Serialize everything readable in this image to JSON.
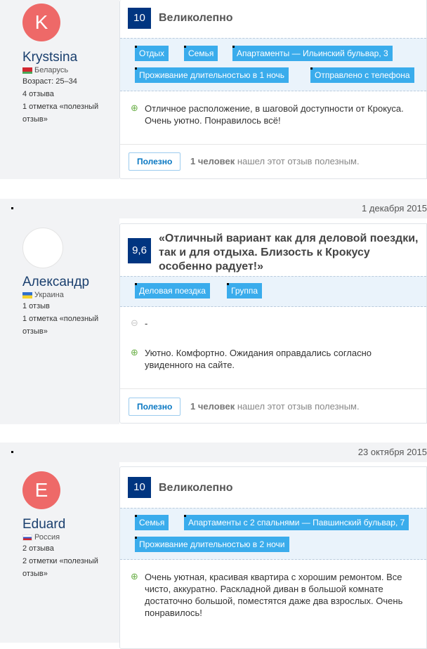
{
  "reviews": [
    {
      "date": "",
      "user": {
        "initial": "K",
        "name": "Krystsina",
        "country": "Беларусь",
        "age": "Возраст: 25–34",
        "reviews_count": "4 отзыва",
        "helpful_marks": "1 отметка «полезный отзыв»"
      },
      "score": "10",
      "headline": "Великолепно",
      "tags": [
        "Отдых",
        "Семья",
        "Апартаменты — Ильинский бульвар, 3",
        "Проживание длительностью в 1 ночь",
        "Отправлено с телефона"
      ],
      "positive": "Отличное расположение, в шаговой доступности от Крокуса. Очень уютно. Понравилось всё!",
      "negative": "",
      "helpful_button": "Полезно",
      "helpful_count": "1 человек",
      "helpful_text": "нашел этот отзыв полезным."
    },
    {
      "date": "1 декабря 2015",
      "user": {
        "initial": "",
        "name": "Александр",
        "country": "Украина",
        "age": "",
        "reviews_count": "1 отзыв",
        "helpful_marks": "1 отметка «полезный отзыв»"
      },
      "score": "9,6",
      "headline": "«Отличный вариант как для деловой поездки, так и для отдыха. Близость к Крокусу особенно радует!»",
      "tags": [
        "Деловая поездка",
        "Группа"
      ],
      "positive": "Уютно. Комфортно. Ожидания оправдались согласно увиденного на сайте.",
      "negative": "-",
      "helpful_button": "Полезно",
      "helpful_count": "1 человек",
      "helpful_text": "нашел этот отзыв полезным."
    },
    {
      "date": "23 октября 2015",
      "user": {
        "initial": "E",
        "name": "Eduard",
        "country": "Россия",
        "age": "",
        "reviews_count": "2 отзыва",
        "helpful_marks": "2 отметки «полезный отзыв»"
      },
      "score": "10",
      "headline": "Великолепно",
      "tags": [
        "Семья",
        "Апартаменты с 2 спальнями — Павшинский бульвар, 7",
        "Проживание длительностью в 2 ночи"
      ],
      "positive": "Очень уютная, красивая квартира с хорошим ремонтом. Все чисто, аккуратно. Раскладной диван в большой комнате достаточно большой, поместятся даже два взрослых. Очень понравилось!",
      "negative": ""
    }
  ],
  "icons": {
    "positive": "plus-leaf-icon",
    "negative": "minus-leaf-icon"
  },
  "colors": {
    "score_bg": "#003580",
    "tag_bg": "#3aacec",
    "avatar_bg": "#ee6968",
    "button_text": "#0877c2"
  }
}
